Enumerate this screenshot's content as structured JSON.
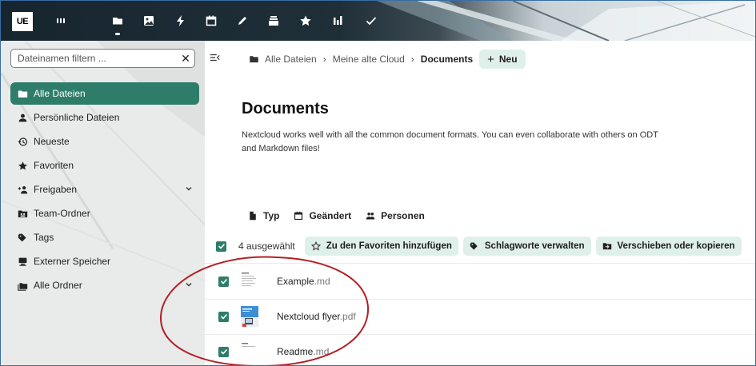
{
  "topbar": {
    "logo_text": "UE",
    "apps": [
      "dashboard-icon",
      "files-icon",
      "photos-icon",
      "activity-icon",
      "calendar-icon",
      "notes-icon",
      "deck-icon",
      "favorites-icon",
      "analytics-icon",
      "tasks-icon"
    ]
  },
  "sidebar": {
    "filter_placeholder": "Dateinamen filtern ...",
    "filter_clear": "✕",
    "items": [
      {
        "label": "Alle Dateien",
        "icon": "folder-icon",
        "active": true
      },
      {
        "label": "Persönliche Dateien",
        "icon": "account-icon"
      },
      {
        "label": "Neueste",
        "icon": "history-icon"
      },
      {
        "label": "Favoriten",
        "icon": "star-icon"
      },
      {
        "label": "Freigaben",
        "icon": "share-icon",
        "expandable": true
      },
      {
        "label": "Team-Ordner",
        "icon": "team-folder-icon"
      },
      {
        "label": "Tags",
        "icon": "tag-icon"
      },
      {
        "label": "Externer Speicher",
        "icon": "external-storage-icon"
      },
      {
        "label": "Alle Ordner",
        "icon": "folders-icon",
        "expandable": true
      }
    ]
  },
  "breadcrumb": {
    "items": [
      "Alle Dateien",
      "Meine alte Cloud",
      "Documents"
    ],
    "separator": "›",
    "new_label": "Neu",
    "new_plus": "+"
  },
  "main": {
    "title": "Documents",
    "description": "Nextcloud works well with all the common document formats. You can even collaborate with others on ODT and Markdown files!",
    "filters": [
      {
        "label": "Typ",
        "icon": "file-type-icon"
      },
      {
        "label": "Geändert",
        "icon": "calendar-icon"
      },
      {
        "label": "Personen",
        "icon": "people-icon"
      }
    ],
    "selection": {
      "count_label": "4 ausgewählt",
      "actions": [
        {
          "label": "Zu den Favoriten hinzufügen",
          "icon": "star-outline-icon"
        },
        {
          "label": "Schlagworte verwalten",
          "icon": "tag-icon"
        },
        {
          "label": "Verschieben oder kopieren",
          "icon": "move-icon"
        }
      ]
    },
    "files": [
      {
        "base": "Example",
        "ext": ".md",
        "checked": true,
        "thumb": "text"
      },
      {
        "base": "Nextcloud flyer",
        "ext": ".pdf",
        "checked": true,
        "thumb": "flyer"
      },
      {
        "base": "Readme",
        "ext": ".md",
        "checked": true,
        "thumb": "text"
      }
    ]
  },
  "colors": {
    "accent": "#2e7d6a",
    "accent_light": "#dff0eb",
    "annotation": "#b21f24"
  }
}
